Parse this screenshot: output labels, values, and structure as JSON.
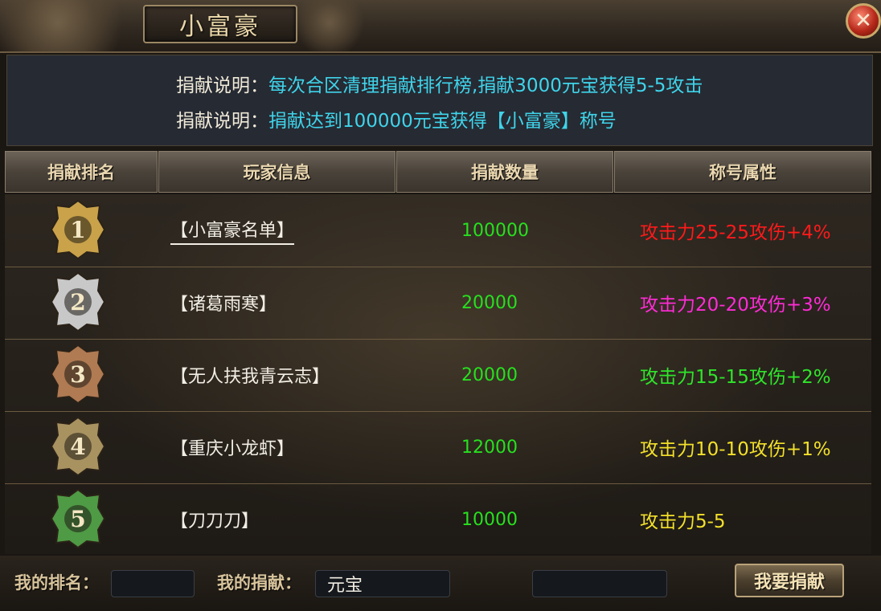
{
  "window": {
    "title": "小富豪",
    "close_icon": "close-icon"
  },
  "info": [
    {
      "label": "捐献说明：",
      "text": "每次合区清理捐献排行榜,捐献3000元宝获得5-5攻击"
    },
    {
      "label": "捐献说明：",
      "text": "捐献达到100000元宝获得【小富豪】称号"
    }
  ],
  "table": {
    "headers": [
      "捐献排名",
      "玩家信息",
      "捐献数量",
      "称号属性"
    ],
    "rows": [
      {
        "rank": "1",
        "name": "【小富豪名单】",
        "amount": "100000",
        "attr": "攻击力25-25攻伤+4%",
        "attr_color": "#ff1a1a",
        "medal_color": "#c9a24a"
      },
      {
        "rank": "2",
        "name": "【诸葛雨寒】",
        "amount": "20000",
        "attr": "攻击力20-20攻伤+3%",
        "attr_color": "#ff2bd6",
        "medal_color": "#c8c8c8"
      },
      {
        "rank": "3",
        "name": "【无人扶我青云志】",
        "amount": "20000",
        "attr": "攻击力15-15攻伤+2%",
        "attr_color": "#2fe52a",
        "medal_color": "#b07a52"
      },
      {
        "rank": "4",
        "name": "【重庆小龙虾】",
        "amount": "12000",
        "attr": "攻击力10-10攻伤+1%",
        "attr_color": "#f2e02a",
        "medal_color": "#a89260"
      },
      {
        "rank": "5",
        "name": "【刀刀刀】",
        "amount": "10000",
        "attr": "攻击力5-5",
        "attr_color": "#f2e02a",
        "medal_color": "#4f9a45"
      }
    ]
  },
  "footer": {
    "my_rank_label": "我的排名：",
    "my_rank_value": "",
    "my_donation_label": "我的捐献：",
    "my_donation_value": "元宝",
    "extra_value": "",
    "donate_button": "我要捐献"
  }
}
